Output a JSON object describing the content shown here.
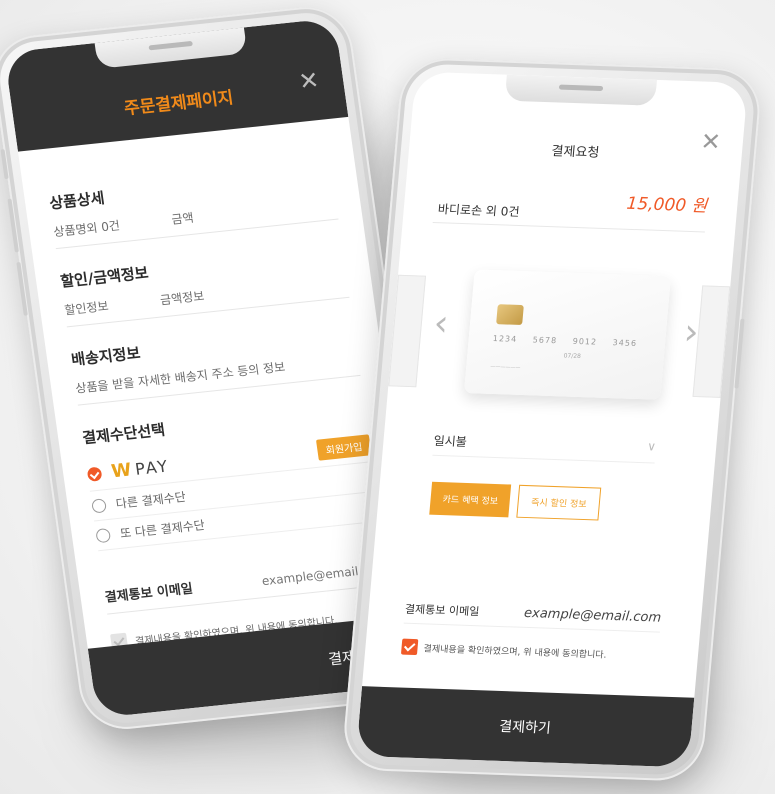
{
  "left_phone": {
    "header": {
      "title": "주문결제페이지"
    },
    "sections": {
      "product": {
        "title": "상품상세",
        "label": "상품명외 0건",
        "value": "금액"
      },
      "discount": {
        "title": "할인/금액정보",
        "label": "할인정보",
        "value": "금액정보"
      },
      "shipping": {
        "title": "배송지정보",
        "description": "상품을 받을 자세한 배송지 주소 등의 정보"
      },
      "payment": {
        "title": "결제수단선택",
        "options": [
          {
            "label": "PAY",
            "brand_mark": "W",
            "selected": true
          },
          {
            "label": "다른 결제수단",
            "selected": false
          },
          {
            "label": "또 다른 결제수단",
            "selected": false
          }
        ],
        "join_badge": "회원가입"
      }
    },
    "email": {
      "label": "결제통보 이메일",
      "value": "example@email.com"
    },
    "agreement": {
      "text": "결제내용을 확인하였으며, 위 내용에 동의합니다.",
      "checked": true
    },
    "footer": {
      "pay_label": "결제하기"
    }
  },
  "right_phone": {
    "header": {
      "title": "결제요청"
    },
    "product": {
      "name": "바디로손 외 0건",
      "price": "15,000 원"
    },
    "card": {
      "number": "1234  5678  9012  3456",
      "expiry": "07/28"
    },
    "installment": {
      "value": "일시불"
    },
    "buttons": {
      "card_benefit": "카드 혜택 정보",
      "instant_discount": "즉시 할인 정보"
    },
    "email": {
      "label": "결제통보 이메일",
      "value": "example@email.com"
    },
    "agreement": {
      "text": "결제내용을 확인하였으며, 위 내용에 동의합니다.",
      "checked": true
    },
    "footer": {
      "pay_label": "결제하기"
    }
  },
  "icons": {
    "close": "close-icon",
    "prev": "chevron-left-icon",
    "next": "chevron-right-icon",
    "dropdown": "chevron-down-icon"
  },
  "colors": {
    "accent_orange": "#f0a22a",
    "accent_red": "#f05a28",
    "dark_bar": "#333333"
  }
}
